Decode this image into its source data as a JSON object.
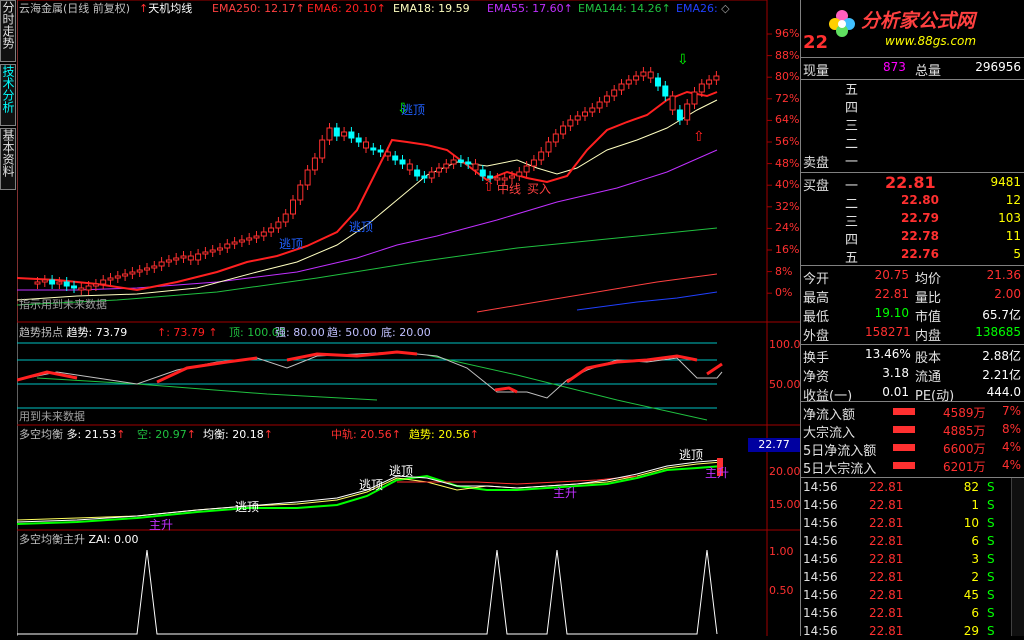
{
  "nav": {
    "tabs": [
      "分时走势",
      "技术分析",
      "基本资料"
    ]
  },
  "main": {
    "title": "云海金属(日线 前复权)",
    "indicator": "天机均线",
    "ema250": "EMA250: 12.17",
    "ema6": "EMA6: 20.10",
    "ema18": "EMA18: 19.59",
    "ema55": "EMA55: 17.60",
    "ema144": "EMA144: 14.26",
    "ema26": "EMA26:",
    "yaxis": [
      "96%",
      "88%",
      "80%",
      "72%",
      "64%",
      "56%",
      "48%",
      "40%",
      "32%",
      "24%",
      "16%",
      "8%",
      "0%"
    ],
    "note": "指示用到未来数据",
    "labels": {
      "escape1": "逃顶",
      "escape2": "逃顶",
      "escape3": "逃顶",
      "mid": "中线",
      "buy": "买入"
    },
    "colors": {
      "ema6": "#ff2020",
      "ema18": "#ffffc0",
      "ema55": "#c030ff",
      "ema144": "#20c040",
      "ema250": "#ff4040",
      "ema26": "#2040ff"
    }
  },
  "sub1": {
    "title": "趋势拐点",
    "trend_label": "趋势: 73.79",
    "trend2": ": 73.79",
    "top": "顶: 100.00",
    "strong": "强: 80.00",
    "trend3": "趋: 50.00",
    "bottom": "底: 20.00",
    "yaxis": [
      "100.0",
      "50.00"
    ],
    "note": "用到未来数据"
  },
  "sub2": {
    "title": "多空均衡",
    "duo": "多: 21.53",
    "kong": "空: 20.97",
    "junheng": "均衡: 20.18",
    "zhonggui": "中轨: 20.56",
    "qushi": "趋势: 20.56",
    "yaxis": [
      "20.00",
      "15.00"
    ],
    "price_tag": "22.77",
    "labels": {
      "e1": "逃顶",
      "e2": "逃顶",
      "e3": "逃顶",
      "e4": "逃顶",
      "z1": "主升",
      "z2": "主升",
      "z3": "主升"
    }
  },
  "sub3": {
    "title": "多空均衡主升",
    "zai": "ZAI: 0.00",
    "yaxis": [
      "1.00",
      "0.50"
    ]
  },
  "quote": {
    "price_big": "22",
    "logo_text": "分析家公式网",
    "logo_url": "www.88gs.com",
    "xianpan_label": "现量",
    "xianpan_val": "873",
    "zongliang_label": "总量",
    "zongliang_val": "296956",
    "sell_label": "卖盘",
    "sell_levels": [
      "五",
      "四",
      "三",
      "二",
      "一"
    ],
    "buy_label": "买盘",
    "buy": [
      {
        "lvl": "一",
        "price": "22.81",
        "vol": "9481"
      },
      {
        "lvl": "二",
        "price": "22.80",
        "vol": "12"
      },
      {
        "lvl": "三",
        "price": "22.79",
        "vol": "103"
      },
      {
        "lvl": "四",
        "price": "22.78",
        "vol": "11"
      },
      {
        "lvl": "五",
        "price": "22.76",
        "vol": "5"
      }
    ],
    "stats": [
      {
        "l1": "今开",
        "v1": "20.75",
        "l2": "均价",
        "v2": "21.36"
      },
      {
        "l1": "最高",
        "v1": "22.81",
        "l2": "量比",
        "v2": "2.00"
      },
      {
        "l1": "最低",
        "v1": "19.10",
        "l2": "市值",
        "v2": "65.7亿"
      },
      {
        "l1": "外盘",
        "v1": "158271",
        "l2": "内盘",
        "v2": "138685"
      }
    ],
    "stats2": [
      {
        "l1": "换手",
        "v1": "13.46%",
        "l2": "股本",
        "v2": "2.88亿"
      },
      {
        "l1": "净资",
        "v1": "3.18",
        "l2": "流通",
        "v2": "2.21亿"
      },
      {
        "l1": "收益(一)",
        "v1": "0.01",
        "l2": "PE(动)",
        "v2": "444.0"
      }
    ],
    "flows": [
      {
        "label": "净流入额",
        "val": "4589万",
        "pct": "7%"
      },
      {
        "label": "大宗流入",
        "val": "4885万",
        "pct": "8%"
      },
      {
        "label": "5日净流入额",
        "val": "6600万",
        "pct": "4%"
      },
      {
        "label": "5日大宗流入",
        "val": "6201万",
        "pct": "4%"
      }
    ],
    "ticks": [
      {
        "t": "14:56",
        "p": "22.81",
        "v": "82",
        "s": "S"
      },
      {
        "t": "14:56",
        "p": "22.81",
        "v": "1",
        "s": "S"
      },
      {
        "t": "14:56",
        "p": "22.81",
        "v": "10",
        "s": "S"
      },
      {
        "t": "14:56",
        "p": "22.81",
        "v": "6",
        "s": "S"
      },
      {
        "t": "14:56",
        "p": "22.81",
        "v": "3",
        "s": "S"
      },
      {
        "t": "14:56",
        "p": "22.81",
        "v": "2",
        "s": "S"
      },
      {
        "t": "14:56",
        "p": "22.81",
        "v": "45",
        "s": "S"
      },
      {
        "t": "14:56",
        "p": "22.81",
        "v": "6",
        "s": "S"
      },
      {
        "t": "14:56",
        "p": "22.81",
        "v": "29",
        "s": "S"
      }
    ]
  }
}
